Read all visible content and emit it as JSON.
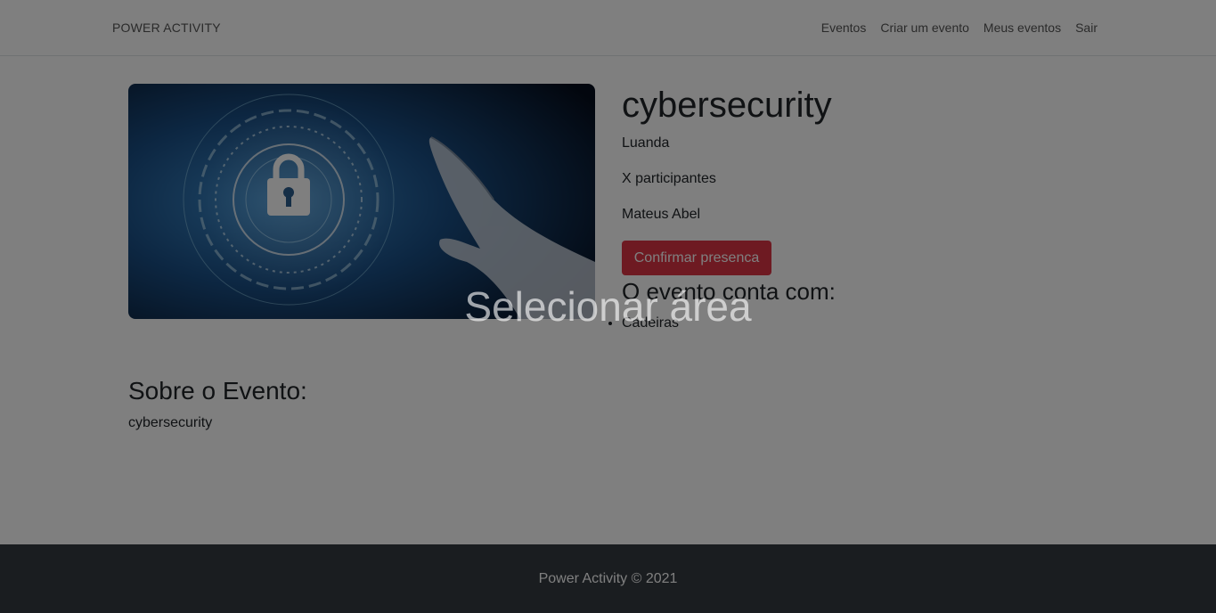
{
  "navbar": {
    "brand": "POWER ACTIVITY",
    "links": [
      "Eventos",
      "Criar um evento",
      "Meus eventos",
      "Sair"
    ]
  },
  "event": {
    "image_icons": [
      "padlock-icon",
      "hand-icon"
    ],
    "title": "cybersecurity",
    "location": "Luanda",
    "participants": "X participantes",
    "organizer": "Mateus Abel",
    "confirm_button": "Confirmar presenca",
    "features_heading": "O evento conta com:",
    "features": [
      "Cadeiras"
    ]
  },
  "about": {
    "heading": "Sobre o Evento:",
    "text": "cybersecurity"
  },
  "footer": {
    "text": "Power Activity © 2021"
  },
  "overlay": {
    "label": "Selecionar área"
  },
  "colors": {
    "button": "#dc3545",
    "footer": "#343a40"
  }
}
